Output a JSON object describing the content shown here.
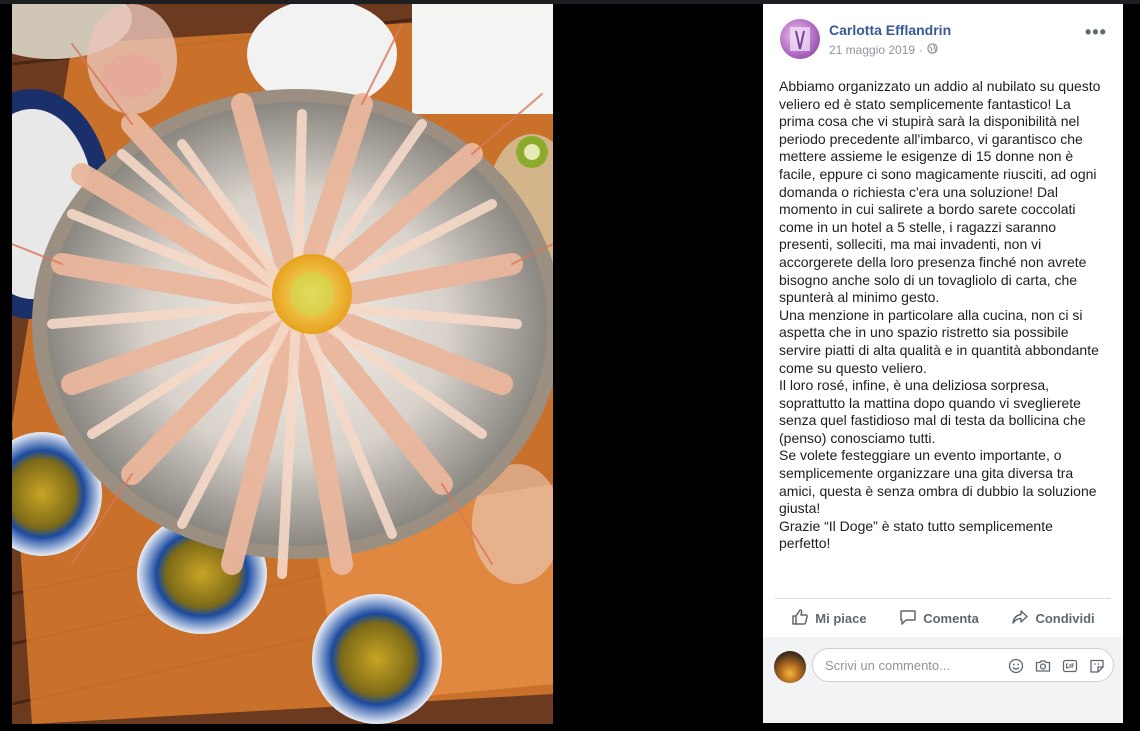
{
  "post": {
    "author": "Carlotta Efflandrin",
    "date": "21 maggio 2019",
    "paragraphs": [
      "Abbiamo organizzato un addio al nubilato su questo veliero ed è stato semplicemente fantastico! La prima cosa che vi stupirà sarà la disponibilità nel periodo precedente all'imbarco, vi garantisco che mettere assieme le esigenze di 15 donne non è facile, eppure ci sono magicamente riusciti, ad ogni domanda o richiesta c'era una soluzione! Dal momento in cui salirete a bordo sarete coccolati come in un hotel a 5 stelle, i ragazzi saranno presenti, solleciti, ma mai invadenti, non vi accorgerete della loro presenza finché non avrete bisogno anche solo di un tovagliolo di carta, che spunterà al minimo gesto.",
      "Una menzione in particolare alla cucina, non ci si aspetta che in uno spazio ristretto sia possibile servire piatti di alta qualità e in quantità abbondante come su questo veliero.",
      "Il loro rosé, infine, è una deliziosa sorpresa, soprattutto la mattina dopo quando vi sveglierete senza quel fastidioso mal di testa da bollicina che (penso) conosciamo tutti.",
      "Se volete festeggiare un evento importante, o semplicemente organizzare una gita diversa tra amici, questa è senza ombra di dubbio la soluzione giusta!",
      "Grazie “Il Doge” è stato tutto semplicemente perfetto!"
    ]
  },
  "actions": {
    "like": "Mi piace",
    "comment": "Comenta",
    "share": "Condividi"
  },
  "comment_box": {
    "placeholder": "Scrivi un commento..."
  },
  "icons": {
    "more": "more-icon",
    "privacy": "globe-icon",
    "like": "thumbs-up-icon",
    "comment": "speech-bubble-icon",
    "share": "share-arrow-icon",
    "emoji": "smiley-icon",
    "camera": "camera-icon",
    "gif": "gif-icon",
    "sticker": "sticker-icon"
  },
  "colors": {
    "author_link": "#385898",
    "meta_text": "#90949c",
    "action_text": "#606770",
    "comment_bg": "#f2f3f5"
  }
}
